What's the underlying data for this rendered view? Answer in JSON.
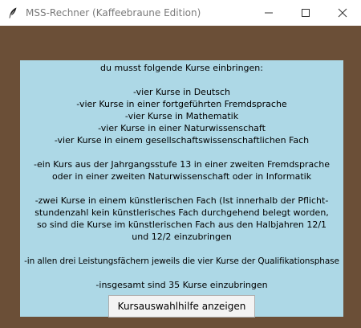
{
  "window": {
    "title": "MSS-Rechner (Kaffeebraune Edition)",
    "app_icon": "feather-icon",
    "controls": [
      "minimize-icon",
      "maximize-icon",
      "close-icon"
    ],
    "background_color": "#6b4f37",
    "panel_color": "#add8e6"
  },
  "info": {
    "lines": [
      "du musst folgende Kurse einbringen:",
      "",
      "-vier Kurse in Deutsch",
      "-vier Kurse in einer fortgeführten Fremdsprache",
      "-vier Kurse in Mathematik",
      "-vier Kurse in einer Naturwissenschaft",
      "-vier Kurse in einem gesellschaftswissenschaftlichen Fach",
      "",
      "-ein Kurs aus der Jahrgangsstufe 13 in einer zweiten Fremdsprache",
      "oder in einer zweiten Naturwissenschaft oder in Informatik",
      "",
      "-zwei Kurse in einem künstlerischen Fach (Ist innerhalb der Pflicht-",
      "stundenzahl kein künstlerisches Fach durchgehend belegt worden,",
      "so sind die Kurse im künstlerischen Fach aus den Halbjahren 12/1",
      "und 12/2 einzubringen",
      "",
      "-in allen drei Leistungsfächern jeweils die vier Kurse der Qualifikationsphase",
      "",
      "-insgesamt sind 35 Kurse einzubringen"
    ]
  },
  "button": {
    "label": "Kursauswahlhilfe anzeigen"
  }
}
